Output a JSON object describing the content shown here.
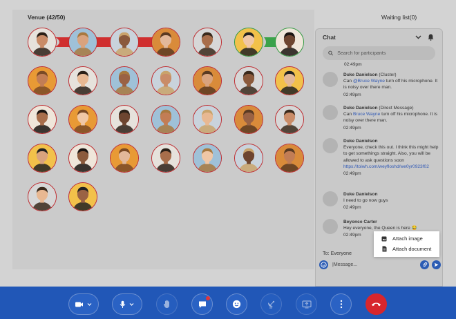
{
  "venue": {
    "title": "Venue (42/50)",
    "waiting_list": "Waiting list(0)"
  },
  "participants": {
    "skin_tones": [
      "#c98c68",
      "#d9a37e",
      "#8b5a3c",
      "#e2b89a",
      "#a86e4b",
      "#f0c7a6",
      "#6d4530",
      "#c27d55",
      "#e8b892",
      "#9a6244"
    ],
    "hair_tones": [
      "#2b2017",
      "#5a3a22",
      "#1a1411",
      "#a8793f",
      "#3a2a1c",
      "#7a4a26",
      "#c9a36b",
      "#222222"
    ],
    "bg_tones": [
      "#e6e2dc",
      "#f2c14a",
      "#c9d3dc",
      "#e89a35",
      "#d7d7d7",
      "#9fc1d8",
      "#efe6da",
      "#d98b3a"
    ]
  },
  "chat": {
    "title": "Chat",
    "search_placeholder": "Search for participants",
    "first_time": "02:49pm",
    "messages": [
      {
        "author": "Duke Danielson",
        "tag": "(Cluster)",
        "pre": "Can ",
        "mention": "@Bruce Wayne",
        "text": " turn off his microphone. It is noisy over there man.",
        "link": "",
        "time": "02:49pm"
      },
      {
        "author": "Duke Danielson",
        "tag": "(Direct Message)",
        "pre": "Can ",
        "mention": "Bruce Wayne",
        "text": " turn off his microphone. It is noisy over there man.",
        "link": "",
        "time": "02:49pm"
      },
      {
        "author": "Duke Danielson",
        "tag": "",
        "pre": "",
        "mention": "",
        "text": "Everyone, check this out. I think this might help to get somethings straight. Also, you will be allowed to ask questions soon ",
        "link": "https://toiwh.com/weyfloshd/we0yr0923f02",
        "time": "02:49pm"
      },
      {
        "author": "Duke Danielson",
        "tag": "",
        "pre": "",
        "mention": "",
        "text": "I need to go now guys",
        "link": "",
        "time": "02:49pm"
      },
      {
        "author": "Beyonce Carter",
        "tag": "",
        "pre": "",
        "mention": "",
        "text": "Hey everyone, the Queen is here 😂",
        "link": "",
        "time": "02:49pm"
      }
    ],
    "to_label": "To: Everyone",
    "message_placeholder": "|Message...",
    "attach_menu": {
      "image": "Attach image",
      "document": "Attach document"
    }
  },
  "toolbar": {
    "items": [
      "camera",
      "microphone",
      "raise-hand",
      "chat",
      "emoji",
      "satellite",
      "share-screen",
      "more",
      "end-call"
    ]
  },
  "colors": {
    "accent": "#2157b7",
    "ring_red": "#c0282d",
    "ring_green": "#2e9a3e",
    "end_call": "#d7262d",
    "link": "#2f58b5"
  }
}
